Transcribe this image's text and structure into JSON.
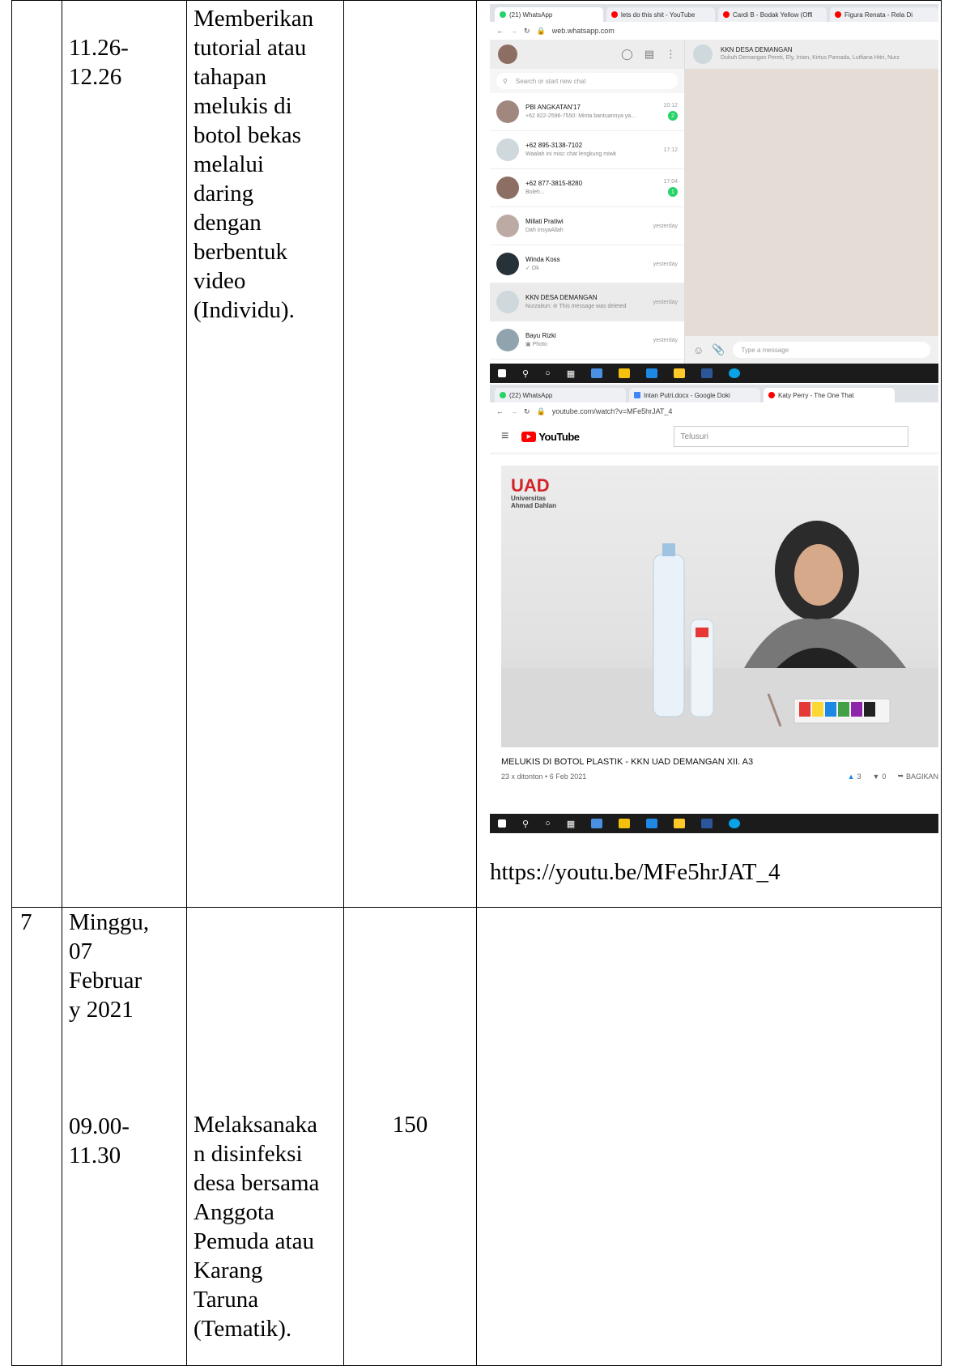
{
  "row_prev": {
    "time": [
      "11.26-",
      "12.26"
    ],
    "activity": [
      "Memberikan",
      "tutorial atau",
      "tahapan",
      "melukis di",
      "botol bekas",
      "melalui",
      "daring",
      "dengan",
      "berbentuk",
      "video",
      "(Individu)."
    ],
    "link": "https://youtu.be/MFe5hrJAT_4"
  },
  "whatsapp": {
    "tabs": [
      "(21) WhatsApp",
      "lets do this shit - YouTube",
      "Cardi B - Bodak Yellow (Offi",
      "Figura Renata - Rela Di"
    ],
    "url": "web.whatsapp.com",
    "search_placeholder": "Search or start new chat",
    "group_name": "KKN DESA DEMANGAN",
    "group_members": "Dukuh Demangan Pereti, Ely, Intan, Kirtus Pamada, Lutfiana Hitri, Nurz",
    "message_placeholder": "Type a message",
    "chats": [
      {
        "name": "PBI ANGKATAN'17",
        "preview": "+62 822-2596-7550: Minta bantuannya ya...",
        "time": "10:12",
        "badge": "2"
      },
      {
        "name": "+62 895-3138-7102",
        "preview": "Waalah ini misc chat lengkung miwk",
        "time": "17:12",
        "badge": ""
      },
      {
        "name": "+62 877-3815-8280",
        "preview": "Boleh...",
        "time": "17:04",
        "badge": "1"
      },
      {
        "name": "Millati Pratiwi",
        "preview": "Dah insyaAllah",
        "time": "yesterday",
        "badge": ""
      },
      {
        "name": "Winda Koss",
        "preview": "✓ Ok",
        "time": "yesterday",
        "badge": ""
      },
      {
        "name": "KKN DESA DEMANGAN",
        "preview": "Nurzaitun: ⊘ This message was deleted",
        "time": "yesterday",
        "badge": ""
      },
      {
        "name": "Bayu Rizki",
        "preview": "▣ Photo",
        "time": "yesterday",
        "badge": ""
      }
    ]
  },
  "youtube": {
    "tabs": [
      "(22) WhatsApp",
      "Intan Putri.docx - Google Doki",
      "Katy Perry - The One That"
    ],
    "url": "youtube.com/watch?v=MFe5hrJAT_4",
    "logo": "YouTube",
    "search_placeholder": "Telusuri",
    "uad_logo": "UAD",
    "uad_sub": [
      "Universitas",
      "Ahmad Dahlan"
    ],
    "video_title": "MELUKIS DI BOTOL PLASTIK - KKN UAD DEMANGAN XII. A3",
    "views": "23 x ditonton • 6 Feb 2021",
    "likes": "3",
    "dislikes": "0",
    "share": "BAGIKAN"
  },
  "row7": {
    "no": "7",
    "date": [
      "Minggu,",
      "07",
      "Februar",
      "y 2021"
    ],
    "time": [
      "09.00-",
      "11.30"
    ],
    "activity": [
      "Melaksanaka",
      "n disinfeksi",
      "desa bersama",
      "Anggota",
      "Pemuda atau",
      "Karang",
      "Taruna",
      "(Tematik)."
    ],
    "value": "150"
  },
  "colors": {
    "wa_green": "#25d366",
    "yt_red": "#ff0000",
    "uad_red": "#d2232a"
  }
}
